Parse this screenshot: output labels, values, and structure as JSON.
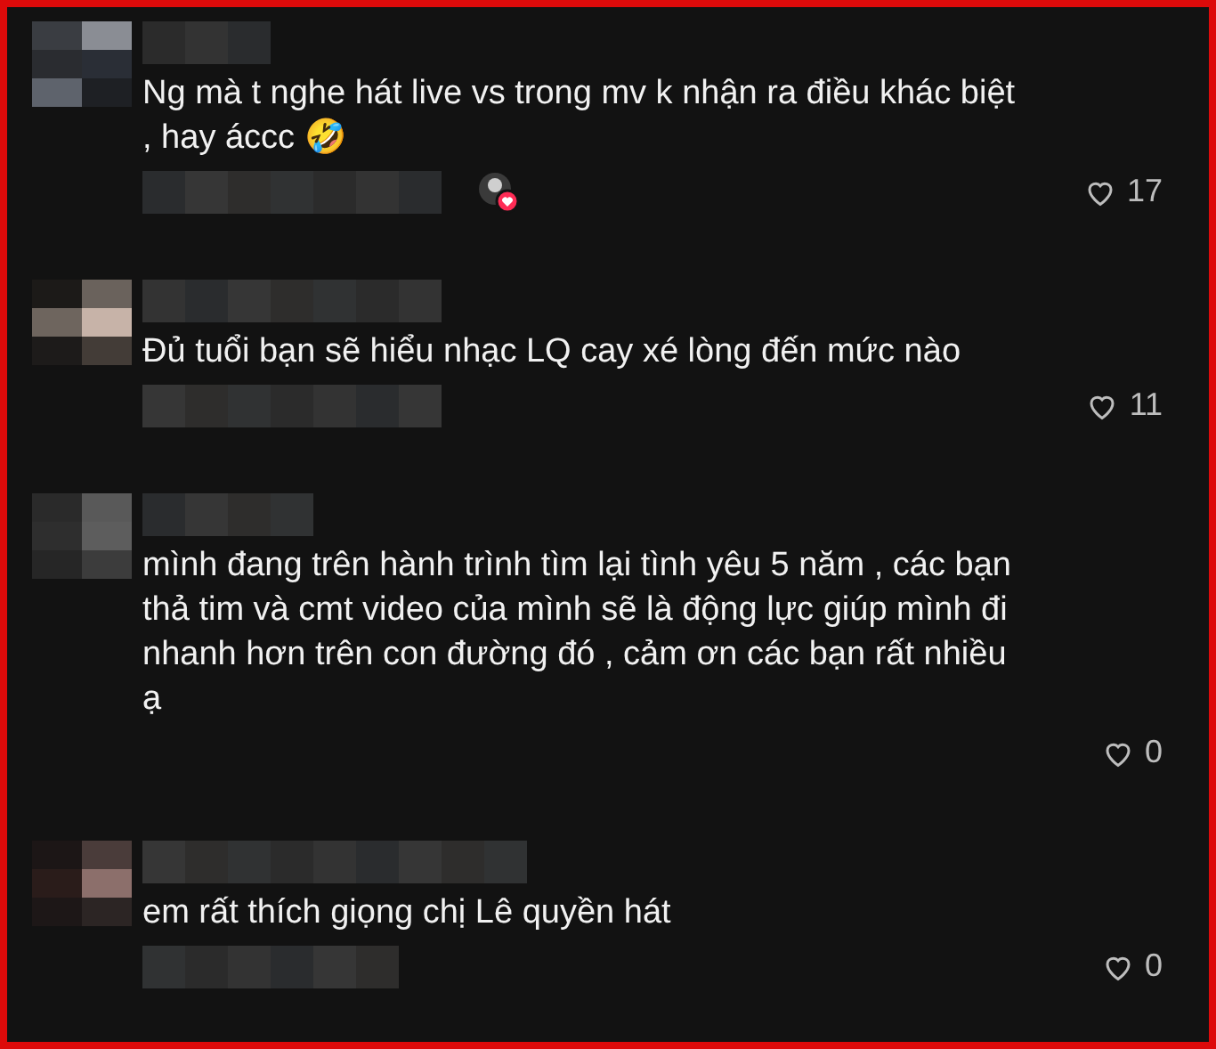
{
  "comments": [
    {
      "text": "Ng mà t nghe hát live vs trong mv k nhận ra điều khác biệt , hay áccc 🤣",
      "creator_liked": true,
      "likes": "17"
    },
    {
      "text": "Đủ tuổi bạn sẽ hiểu nhạc LQ cay xé lòng đến mức nào",
      "creator_liked": false,
      "likes": "11"
    },
    {
      "text": "mình đang trên hành trình tìm lại tình yêu 5 năm , các bạn thả tim và cmt video của mình sẽ là động lực giúp mình đi nhanh hơn trên con đường đó , cảm ơn các bạn rất nhiều ạ",
      "creator_liked": false,
      "likes": "0"
    },
    {
      "text": "em rất thích giọng chị Lê quyền hát",
      "creator_liked": false,
      "likes": "0"
    }
  ]
}
